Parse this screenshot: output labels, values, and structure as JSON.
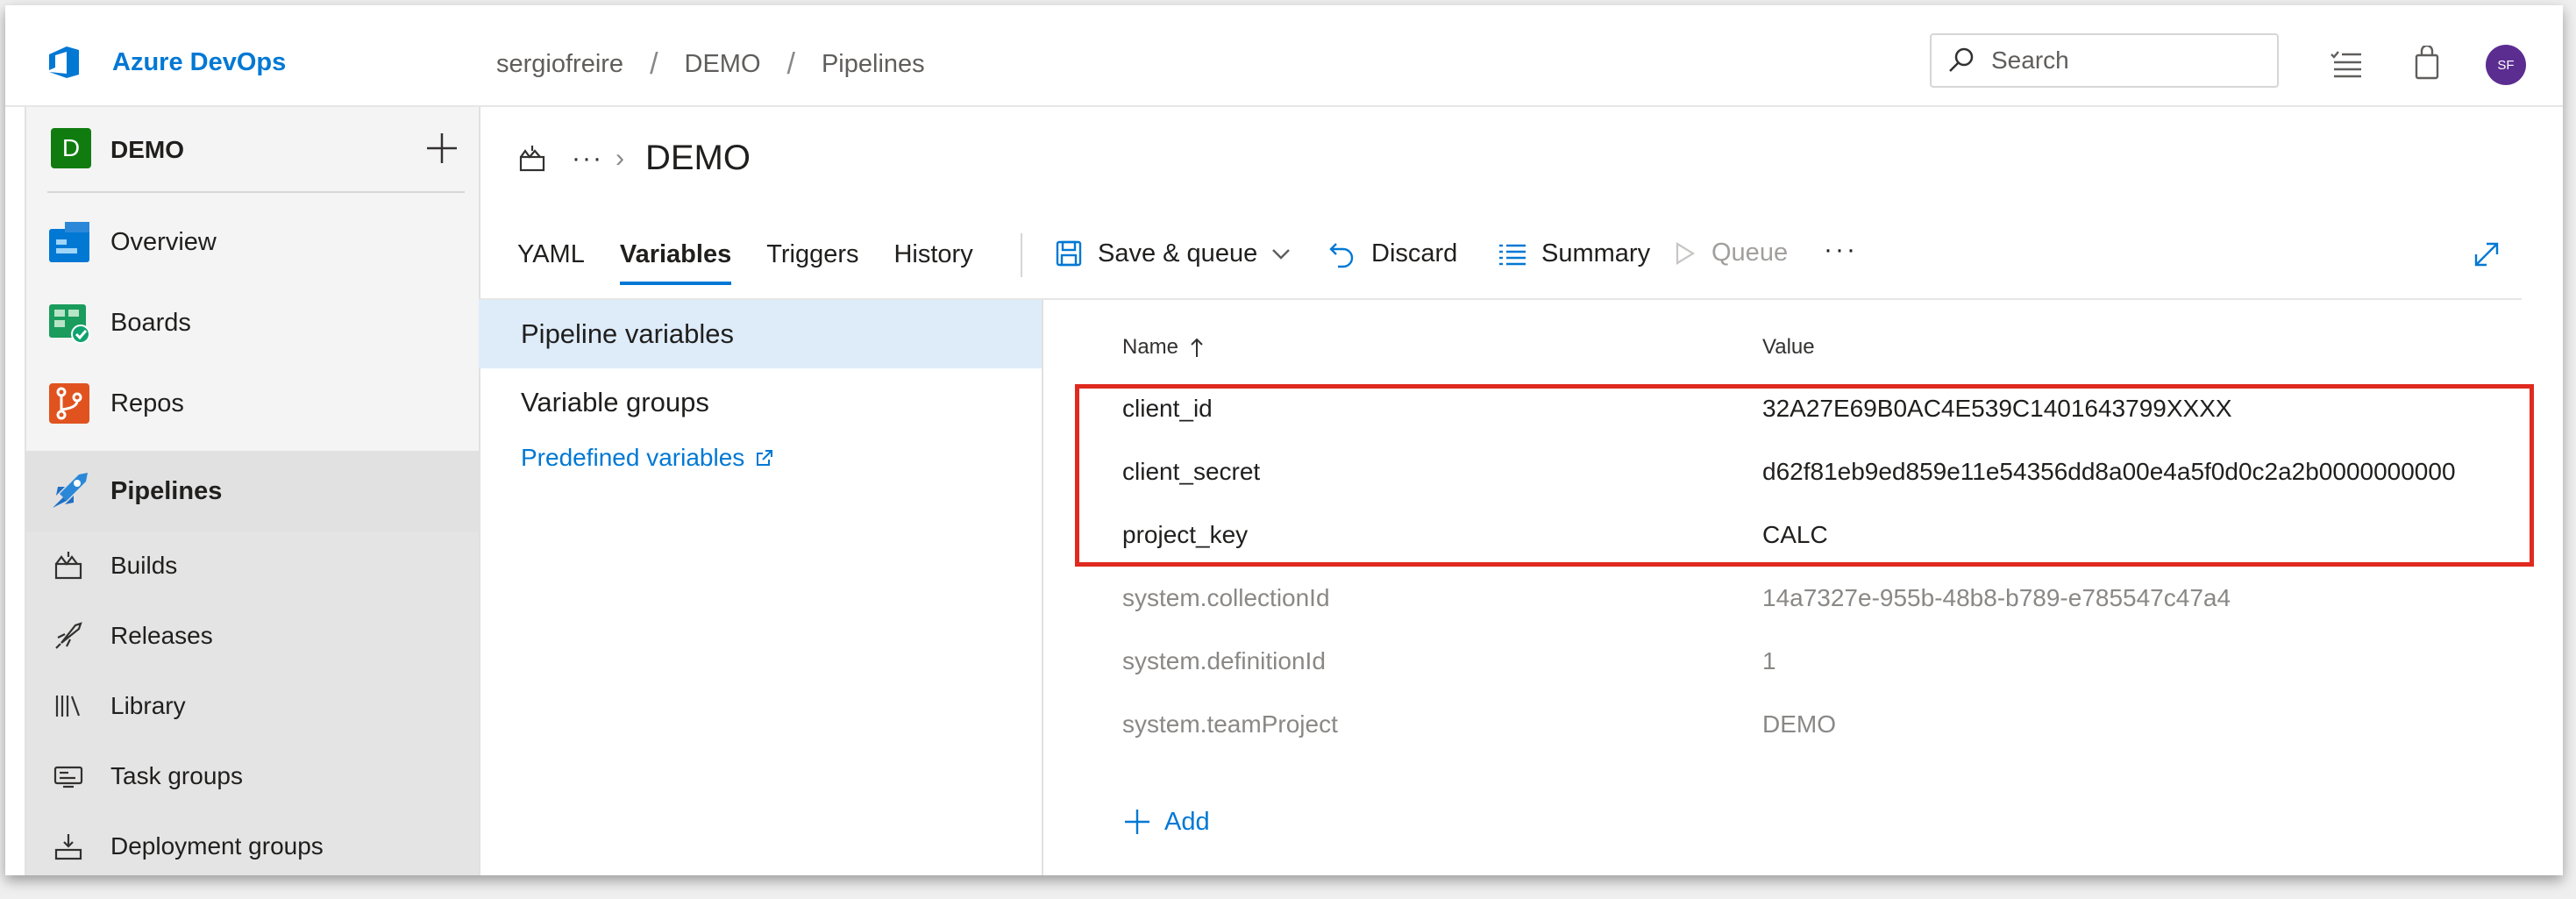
{
  "colors": {
    "accent": "#0078d4",
    "highlight_box": "#e02a1f",
    "project_badge": "#107c10",
    "avatar": "#5c2d91"
  },
  "header": {
    "product": "Azure DevOps",
    "breadcrumb": [
      "sergiofreire",
      "DEMO",
      "Pipelines"
    ],
    "search_placeholder": "Search",
    "avatar_initials": "SF",
    "icons": [
      "task-list-icon",
      "shopping-bag-icon"
    ]
  },
  "sidebar": {
    "project_initial": "D",
    "project_name": "DEMO",
    "items": [
      {
        "label": "Overview",
        "icon": "overview-icon"
      },
      {
        "label": "Boards",
        "icon": "boards-icon"
      },
      {
        "label": "Repos",
        "icon": "repos-icon"
      },
      {
        "label": "Pipelines",
        "icon": "pipelines-icon",
        "active": true
      }
    ],
    "sub_items": [
      {
        "label": "Builds",
        "icon": "builds-icon"
      },
      {
        "label": "Releases",
        "icon": "rocket-icon"
      },
      {
        "label": "Library",
        "icon": "library-icon"
      },
      {
        "label": "Task groups",
        "icon": "task-groups-icon"
      },
      {
        "label": "Deployment groups",
        "icon": "deployment-groups-icon"
      }
    ]
  },
  "page": {
    "ellipsis": "···",
    "title": "DEMO",
    "tabs": [
      {
        "label": "YAML"
      },
      {
        "label": "Variables",
        "active": true
      },
      {
        "label": "Triggers"
      },
      {
        "label": "History"
      }
    ],
    "toolbar": {
      "save_queue": "Save & queue",
      "discard": "Discard",
      "summary": "Summary",
      "queue": "Queue",
      "more": "···"
    }
  },
  "variables_panel": {
    "items": [
      {
        "label": "Pipeline variables",
        "selected": true
      },
      {
        "label": "Variable groups"
      }
    ],
    "predefined_link": "Predefined variables"
  },
  "variables_table": {
    "columns": {
      "name": "Name",
      "value": "Value"
    },
    "rows": [
      {
        "name": "client_id",
        "value": "32A27E69B0AC4E539C1401643799XXXX",
        "highlighted": true
      },
      {
        "name": "client_secret",
        "value": "d62f81eb9ed859e11e54356dd8a00e4a5f0d0c2a2b0000000000",
        "highlighted": true
      },
      {
        "name": "project_key",
        "value": "CALC",
        "highlighted": true
      },
      {
        "name": "system.collectionId",
        "value": "14a7327e-955b-48b8-b789-e785547c47a4",
        "system": true
      },
      {
        "name": "system.definitionId",
        "value": "1",
        "system": true
      },
      {
        "name": "system.teamProject",
        "value": "DEMO",
        "system": true
      }
    ],
    "add_label": "Add"
  }
}
